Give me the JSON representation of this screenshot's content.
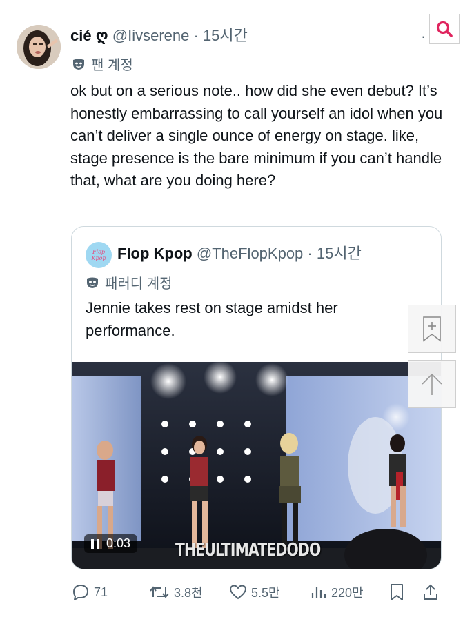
{
  "post": {
    "author_name": "cié ღ",
    "handle": "@Iivserene",
    "separator": "·",
    "time": "15시간",
    "badge_label": "팬 계정",
    "more": "·",
    "text": "ok but on a serious note.. how did she even debut? It’s honestly embarrassing to call yourself an idol when you can’t deliver a single ounce of energy on stage. like, stage presence is the bare minimum if you can’t handle that, what are you doing here?"
  },
  "quote": {
    "avatar_line1": "Flop",
    "avatar_line2": "Kpop",
    "author_name": "Flop Kpop",
    "handle": "@TheFlopKpop",
    "separator": "·",
    "time": "15시간",
    "badge_label": "패러디 계정",
    "text": "Jennie takes rest on stage amidst her performance.",
    "video_time": "0:03",
    "video_watermark": "THEULTIMATEDODO"
  },
  "actions": {
    "replies": "71",
    "reposts": "3.8천",
    "likes": "5.5만",
    "views": "220만"
  },
  "icons": {
    "search": "search-icon",
    "bookmark": "bookmark-icon",
    "share": "share-icon",
    "reply": "reply-icon",
    "repost": "repost-icon",
    "like": "heart-icon",
    "views": "views-icon",
    "scroll_top": "arrow-up-icon",
    "add_bookmark": "bookmark-add-icon"
  },
  "colors": {
    "text": "#0f1419",
    "secondary": "#536471",
    "border": "#cfd9de",
    "search_red": "#e0245e"
  }
}
